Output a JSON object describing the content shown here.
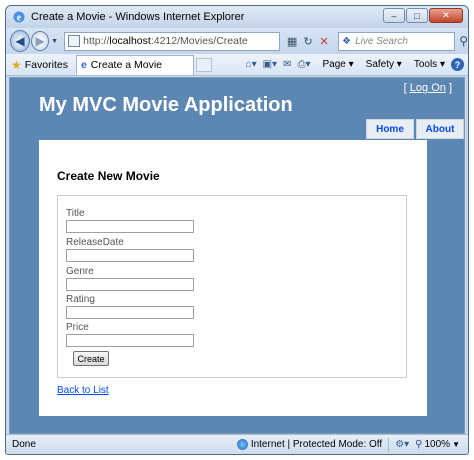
{
  "window": {
    "title": "Create a Movie - Windows Internet Explorer",
    "minimize": "–",
    "maximize": "□",
    "close": "✕"
  },
  "addressbar": {
    "url_prefix": "http://",
    "url_host": "localhost",
    "url_rest": ":4212/Movies/Create",
    "search_placeholder": "Live Search"
  },
  "toolbar": {
    "favorites_label": "Favorites",
    "tab_title": "Create a Movie",
    "page_menu": "Page",
    "safety_menu": "Safety",
    "tools_menu": "Tools",
    "help_icon": "?"
  },
  "site": {
    "logon_open": "[",
    "logon_label": "Log On",
    "logon_close": "]",
    "app_title": "My MVC Movie Application",
    "menu": {
      "home": "Home",
      "about": "About"
    }
  },
  "form": {
    "heading": "Create New Movie",
    "fields": [
      {
        "label": "Title",
        "value": ""
      },
      {
        "label": "ReleaseDate",
        "value": ""
      },
      {
        "label": "Genre",
        "value": ""
      },
      {
        "label": "Rating",
        "value": ""
      },
      {
        "label": "Price",
        "value": ""
      }
    ],
    "submit_label": "Create",
    "back_link": "Back to List"
  },
  "statusbar": {
    "status": "Done",
    "zone": "Internet | Protected Mode: Off",
    "zoom": "100%"
  },
  "icons": {
    "app": "ie-icon",
    "back": "back-arrow-icon",
    "forward": "forward-arrow-icon",
    "refresh": "refresh-icon",
    "stop": "stop-icon",
    "search": "search-icon",
    "favorites": "star-icon",
    "home": "home-icon",
    "feeds": "feed-icon",
    "mail": "mail-icon",
    "print": "printer-icon",
    "globe": "globe-icon",
    "zoom": "magnifier-icon"
  },
  "colors": {
    "site_background": "#5c87b2",
    "menu_link": "#034af3",
    "link": "#034af3"
  }
}
